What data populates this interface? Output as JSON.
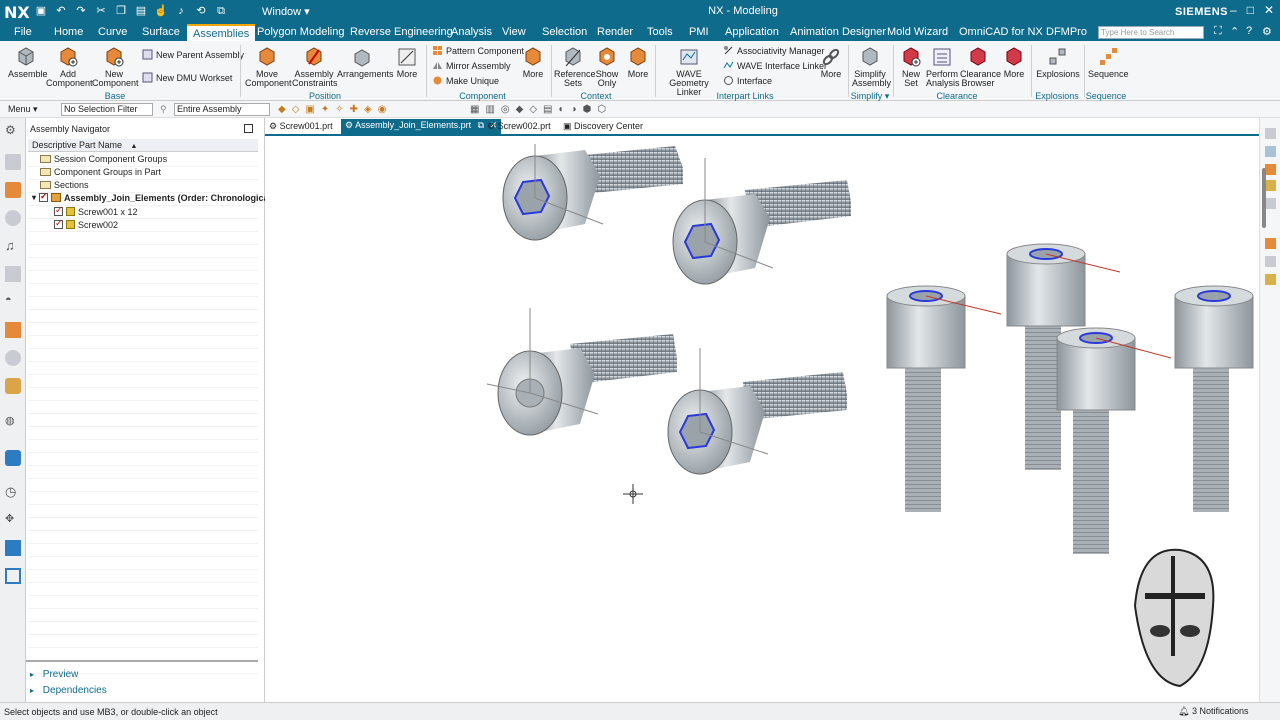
{
  "app": {
    "logo": "NX",
    "window_menu": "Window ▾",
    "title": "NX - Modeling",
    "brand": "SIEMENS"
  },
  "menu": {
    "tabs": [
      "File",
      "Home",
      "Curve",
      "Surface",
      "Assemblies",
      "Polygon Modeling",
      "Reverse Engineering",
      "Analysis",
      "View",
      "Selection",
      "Render",
      "Tools",
      "PMI",
      "Application",
      "Animation Designer",
      "Mold Wizard",
      "OmniCAD for NX",
      "DFMPro"
    ],
    "active": "Assemblies",
    "search_placeholder": "Type Here to Search"
  },
  "ribbon": {
    "buttons": {
      "assemble": "Assemble",
      "add_component": [
        "Add",
        "Component"
      ],
      "new_component": [
        "New",
        "Component"
      ],
      "new_parent_assembly": "New Parent Assembly",
      "new_dmu_workset": "New DMU Workset",
      "move_component": [
        "Move",
        "Component"
      ],
      "assembly_constraints": [
        "Assembly",
        "Constraints"
      ],
      "arrangements": "Arrangements",
      "more1": "More",
      "pattern_component": "Pattern Component",
      "mirror_assembly": "Mirror Assembly",
      "make_unique": "Make Unique",
      "more2": "More",
      "reference_sets": [
        "Reference",
        "Sets"
      ],
      "show_only": [
        "Show",
        "Only"
      ],
      "more3": "More",
      "wave_geometry_linker": [
        "WAVE Geometry",
        "Linker"
      ],
      "associativity_manager": "Associativity Manager",
      "wave_interface_linker": "WAVE Interface Linker",
      "interface": "Interface",
      "more4": "More",
      "simplify_assembly": [
        "Simplify",
        "Assembly"
      ],
      "new_set": [
        "New",
        "Set"
      ],
      "perform_analysis": [
        "Perform",
        "Analysis"
      ],
      "clearance_browser": [
        "Clearance",
        "Browser"
      ],
      "more5": "More",
      "explosions": "Explosions",
      "sequence": "Sequence"
    },
    "groups": {
      "base": "Base",
      "position": "Position",
      "component": "Component",
      "context": "Context",
      "interpart_links": "Interpart Links",
      "simplify": "Simplify ▾",
      "clearance": "Clearance",
      "explosions": "Explosions ▾",
      "sequence": "Sequence ▾"
    }
  },
  "toolbar": {
    "menu": "Menu ▾",
    "selection_filter": "No Selection Filter",
    "scope": "Entire Assembly"
  },
  "navigator": {
    "title": "Assembly Navigator",
    "column": "Descriptive Part Name",
    "rows": [
      "Session Component Groups",
      "Component Groups in Part",
      "Sections",
      "Assembly_Join_Elements (Order: Chronological)",
      "Screw001 x 12",
      "Screw002"
    ],
    "preview": "Preview",
    "dependencies": "Dependencies"
  },
  "doc_tabs": [
    "Screw001.prt",
    "Assembly_Join_Elements.prt",
    "Screw002.prt",
    "Discovery Center"
  ],
  "status": {
    "message": "Select objects and use MB3, or double-click an object",
    "notifications": "3 Notifications"
  },
  "colors": {
    "brand": "#0f6b8c",
    "accent": "#f0a800",
    "screw": "#b8bfc4"
  }
}
